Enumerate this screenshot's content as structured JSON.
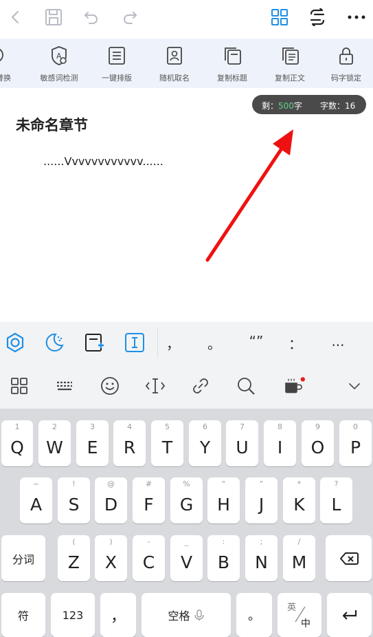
{
  "toolbar": {
    "items": [
      {
        "label": "查找替换",
        "icon": "find-replace-icon"
      },
      {
        "label": "敏感词检测",
        "icon": "sensitive-word-icon"
      },
      {
        "label": "一键排版",
        "icon": "typeset-icon"
      },
      {
        "label": "随机取名",
        "icon": "random-name-icon"
      },
      {
        "label": "复制标题",
        "icon": "copy-title-icon"
      },
      {
        "label": "复制正文",
        "icon": "copy-body-icon"
      },
      {
        "label": "码字锁定",
        "icon": "lock-icon"
      }
    ]
  },
  "editor": {
    "counter": {
      "remain_prefix": "剩：",
      "remain_value": "500",
      "remain_suffix": "字",
      "wordcount": "字数：16"
    },
    "chapter_title": "未命名章节",
    "body": "......Vvvvvvvvvvvv......"
  },
  "quickbar": {
    "punctuation": [
      "，",
      "。",
      "“”",
      "：",
      "..."
    ]
  },
  "keyboard": {
    "row1": [
      {
        "hint": "1",
        "key": "Q"
      },
      {
        "hint": "2",
        "key": "W"
      },
      {
        "hint": "3",
        "key": "E"
      },
      {
        "hint": "4",
        "key": "R"
      },
      {
        "hint": "5",
        "key": "T"
      },
      {
        "hint": "6",
        "key": "Y"
      },
      {
        "hint": "7",
        "key": "U"
      },
      {
        "hint": "8",
        "key": "I"
      },
      {
        "hint": "9",
        "key": "O"
      },
      {
        "hint": "0",
        "key": "P"
      }
    ],
    "row2": [
      {
        "hint": "~",
        "key": "A"
      },
      {
        "hint": "!",
        "key": "S"
      },
      {
        "hint": "@",
        "key": "D"
      },
      {
        "hint": "#",
        "key": "F"
      },
      {
        "hint": "%",
        "key": "G"
      },
      {
        "hint": "“",
        "key": "H"
      },
      {
        "hint": "”",
        "key": "J"
      },
      {
        "hint": "*",
        "key": "K"
      },
      {
        "hint": "?",
        "key": "L"
      }
    ],
    "row3": [
      {
        "hint": "(",
        "key": "Z"
      },
      {
        "hint": ")",
        "key": "X"
      },
      {
        "hint": "-",
        "key": "C"
      },
      {
        "hint": "_",
        "key": "V"
      },
      {
        "hint": ":",
        "key": "B"
      },
      {
        "hint": ";",
        "key": "N"
      },
      {
        "hint": "/",
        "key": "M"
      }
    ],
    "fenci": "分词",
    "fu": "符",
    "num": "123",
    "comma": "，",
    "space": "空格",
    "period": "。",
    "lang_top": "英",
    "lang_bottom": "中"
  }
}
